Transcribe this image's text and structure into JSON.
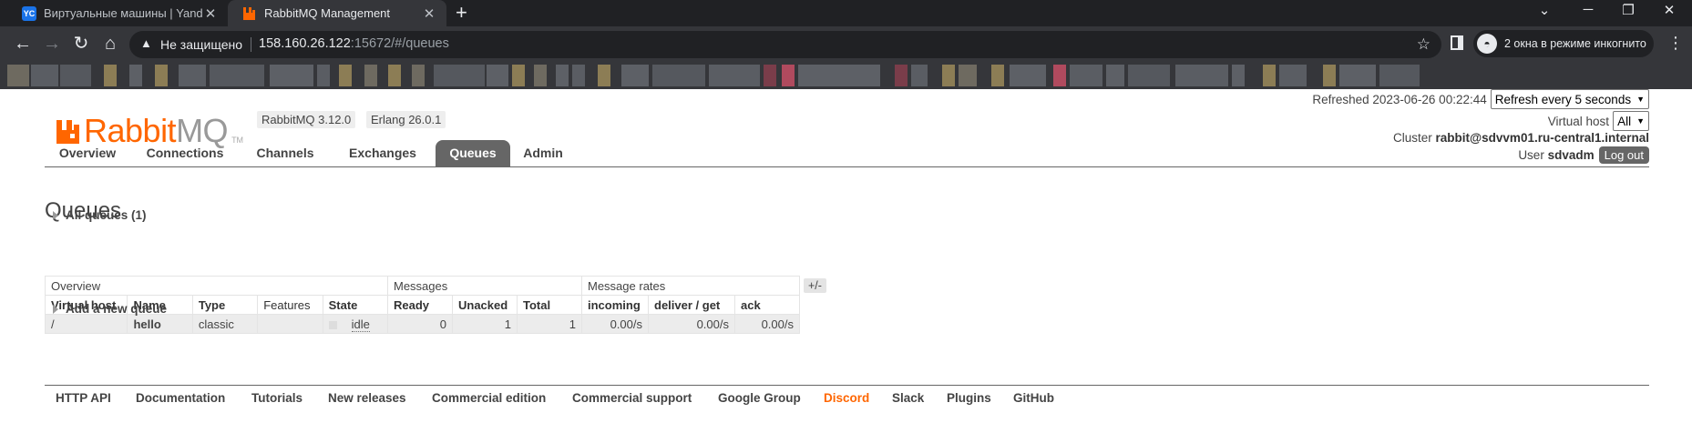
{
  "browser": {
    "tabs": [
      {
        "title": "Виртуальные машины | Yandex Clo",
        "favicon": "YC",
        "favicon_color": "#1a73e8"
      },
      {
        "title": "RabbitMQ Management",
        "favicon": "rabbitmq-icon",
        "favicon_color": "#f60"
      }
    ],
    "security_label": "Не защищено",
    "url_host": "158.160.26.122",
    "url_rest": ":15672/#/queues",
    "incognito_label": "2 окна в режиме инкогнито"
  },
  "app": {
    "logo_rabbit": "Rabbit",
    "logo_mq": "MQ",
    "logo_tm": "TM",
    "version_badge": "RabbitMQ 3.12.0",
    "erlang_badge": "Erlang 26.0.1",
    "refreshed_text": "Refreshed 2023-06-26 00:22:44",
    "refresh_select": "Refresh every 5 seconds",
    "vhost_label": "Virtual host",
    "vhost_select": "All",
    "cluster_label": "Cluster",
    "cluster_name": "rabbit@sdvvm01.ru-central1.internal",
    "user_label": "User",
    "user_name": "sdvadm",
    "logout_label": "Log out",
    "accent_color": "#ff6600"
  },
  "nav": {
    "items": [
      "Overview",
      "Connections",
      "Channels",
      "Exchanges",
      "Queues",
      "Admin"
    ],
    "active": "Queues"
  },
  "main": {
    "title": "Queues",
    "all_queues_toggle": "All queues (1)",
    "add_queue_toggle": "Add a new queue",
    "plus_minus": "+/-",
    "table": {
      "groups": [
        "Overview",
        "Messages",
        "Message rates"
      ],
      "columns": [
        "Virtual host",
        "Name",
        "Type",
        "Features",
        "State",
        "Ready",
        "Unacked",
        "Total",
        "incoming",
        "deliver / get",
        "ack"
      ],
      "rows": [
        {
          "vhost": "/",
          "name": "hello",
          "type": "classic",
          "features": "",
          "state": "idle",
          "ready": "0",
          "unacked": "1",
          "total": "1",
          "incoming": "0.00/s",
          "deliver_get": "0.00/s",
          "ack": "0.00/s"
        }
      ]
    }
  },
  "footer": {
    "links": [
      "HTTP API",
      "Documentation",
      "Tutorials",
      "New releases",
      "Commercial edition",
      "Commercial support",
      "Google Group",
      "Discord",
      "Slack",
      "Plugins",
      "GitHub"
    ],
    "highlight": "Discord"
  }
}
